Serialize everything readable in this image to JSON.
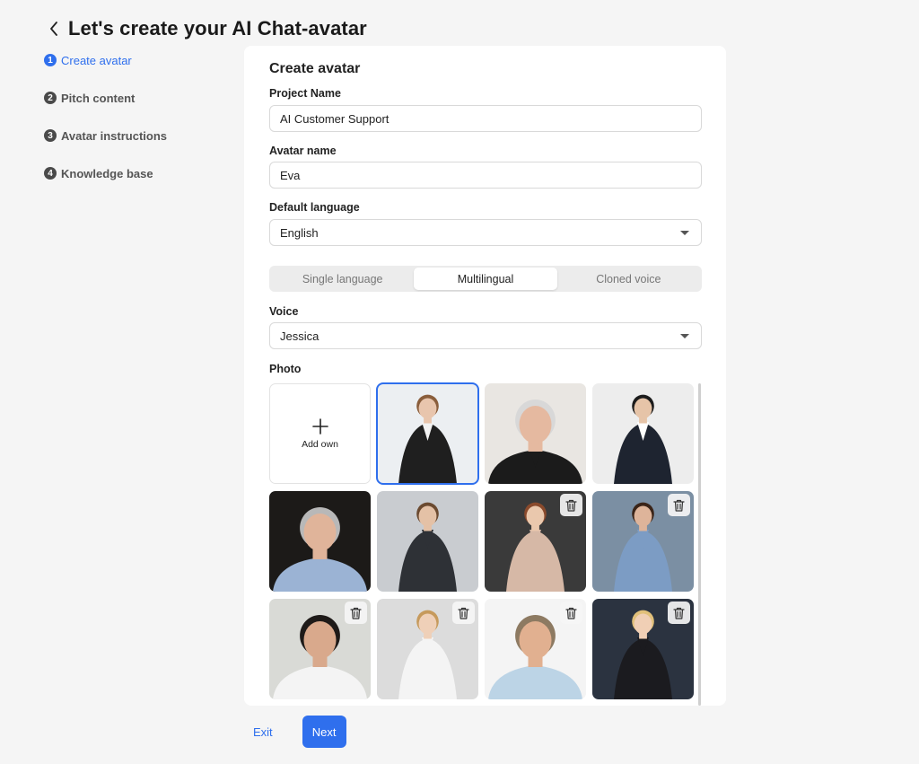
{
  "header": {
    "title": "Let's create your AI Chat-avatar"
  },
  "steps": [
    {
      "num": "1",
      "label": "Create avatar",
      "active": true
    },
    {
      "num": "2",
      "label": "Pitch content",
      "active": false
    },
    {
      "num": "3",
      "label": "Avatar instructions",
      "active": false
    },
    {
      "num": "4",
      "label": "Knowledge base",
      "active": false
    }
  ],
  "form": {
    "title": "Create avatar",
    "project_name_label": "Project Name",
    "project_name_value": "AI Customer Support",
    "avatar_name_label": "Avatar name",
    "avatar_name_value": "Eva",
    "language_label": "Default language",
    "language_value": "English",
    "voice_modes": [
      "Single language",
      "Multilingual",
      "Cloned voice"
    ],
    "voice_mode_selected": "Multilingual",
    "voice_label": "Voice",
    "voice_value": "Jessica",
    "photo_label": "Photo",
    "add_own_label": "Add own",
    "add_own_icon": "plus-icon"
  },
  "photos": [
    {
      "name": "woman-black-blazer",
      "selected": true,
      "deletable": false,
      "bg": "#eceff2"
    },
    {
      "name": "man-black-tshirt",
      "selected": false,
      "deletable": false,
      "bg": "#e9e6e2"
    },
    {
      "name": "woman-suit",
      "selected": false,
      "deletable": false,
      "bg": "#ededed"
    },
    {
      "name": "man-blue-shirt-dark",
      "selected": false,
      "deletable": false,
      "bg": "#1c1a18"
    },
    {
      "name": "woman-scifi-suit",
      "selected": false,
      "deletable": false,
      "bg": "#c9ccd0"
    },
    {
      "name": "woman-glasses",
      "selected": false,
      "deletable": true,
      "bg": "#3a3a3a"
    },
    {
      "name": "woman-lake",
      "selected": false,
      "deletable": true,
      "bg": "#7b8fa3"
    },
    {
      "name": "man-white-shirt",
      "selected": false,
      "deletable": true,
      "bg": "#d9dad6"
    },
    {
      "name": "woman-blonde",
      "selected": false,
      "deletable": true,
      "bg": "#dcdcdc"
    },
    {
      "name": "man-passport",
      "selected": false,
      "deletable": true,
      "bg": "#f4f4f4"
    },
    {
      "name": "woman-dark-bg",
      "selected": false,
      "deletable": true,
      "bg": "#2b3340"
    }
  ],
  "footer": {
    "exit_label": "Exit",
    "next_label": "Next"
  },
  "colors": {
    "accent": "#2f6fed",
    "background": "#f5f5f5"
  }
}
